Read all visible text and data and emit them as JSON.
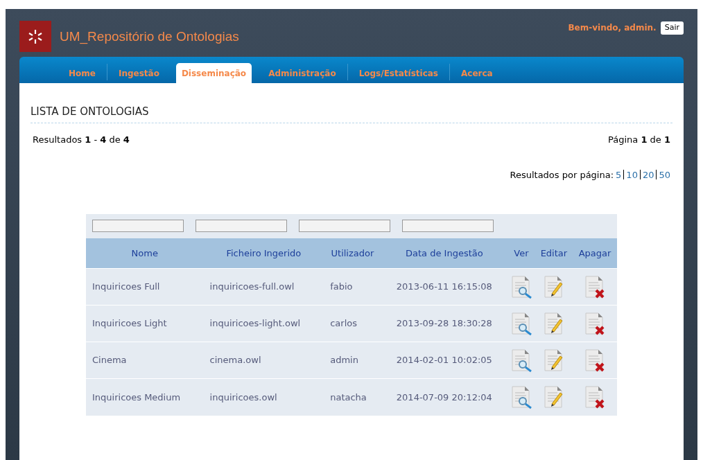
{
  "header": {
    "title": "UM_Repositório de Ontologias",
    "welcome": "Bem-vindo, admin.",
    "logout": "Sair"
  },
  "tabs": [
    {
      "label": "Home",
      "selected": false
    },
    {
      "label": "Ingestão",
      "selected": false
    },
    {
      "label": "Disseminação",
      "selected": true
    },
    {
      "label": "Administração",
      "selected": false
    },
    {
      "label": "Logs/Estatísticas",
      "selected": false
    },
    {
      "label": "Acerca",
      "selected": false
    }
  ],
  "section_title": "LISTA DE ONTOLOGIAS",
  "results_summary": "Resultados **1** - **4** de **4**",
  "page_summary": "Página **1** de **1**",
  "per_page": {
    "label": "Resultados por página:",
    "options": [
      "5",
      "10",
      "20",
      "50"
    ]
  },
  "table": {
    "columns": [
      "Nome",
      "Ficheiro Ingerido",
      "Utilizador",
      "Data de Ingestão",
      "Ver",
      "Editar",
      "Apagar"
    ],
    "rows": [
      {
        "cells": [
          "Inquiricoes Full",
          "inquiricoes-full.owl",
          "fabio",
          "2013-06-11 16:15:08"
        ]
      },
      {
        "cells": [
          "Inquiricoes Light",
          "inquiricoes-light.owl",
          "carlos",
          "2013-09-28 18:30:28"
        ]
      },
      {
        "cells": [
          "Cinema",
          "cinema.owl",
          "admin",
          "2014-02-01 10:02:05"
        ]
      },
      {
        "cells": [
          "Inquiricoes Medium",
          "inquiricoes.owl",
          "natacha",
          "2014-07-09 20:12:04"
        ]
      }
    ]
  }
}
